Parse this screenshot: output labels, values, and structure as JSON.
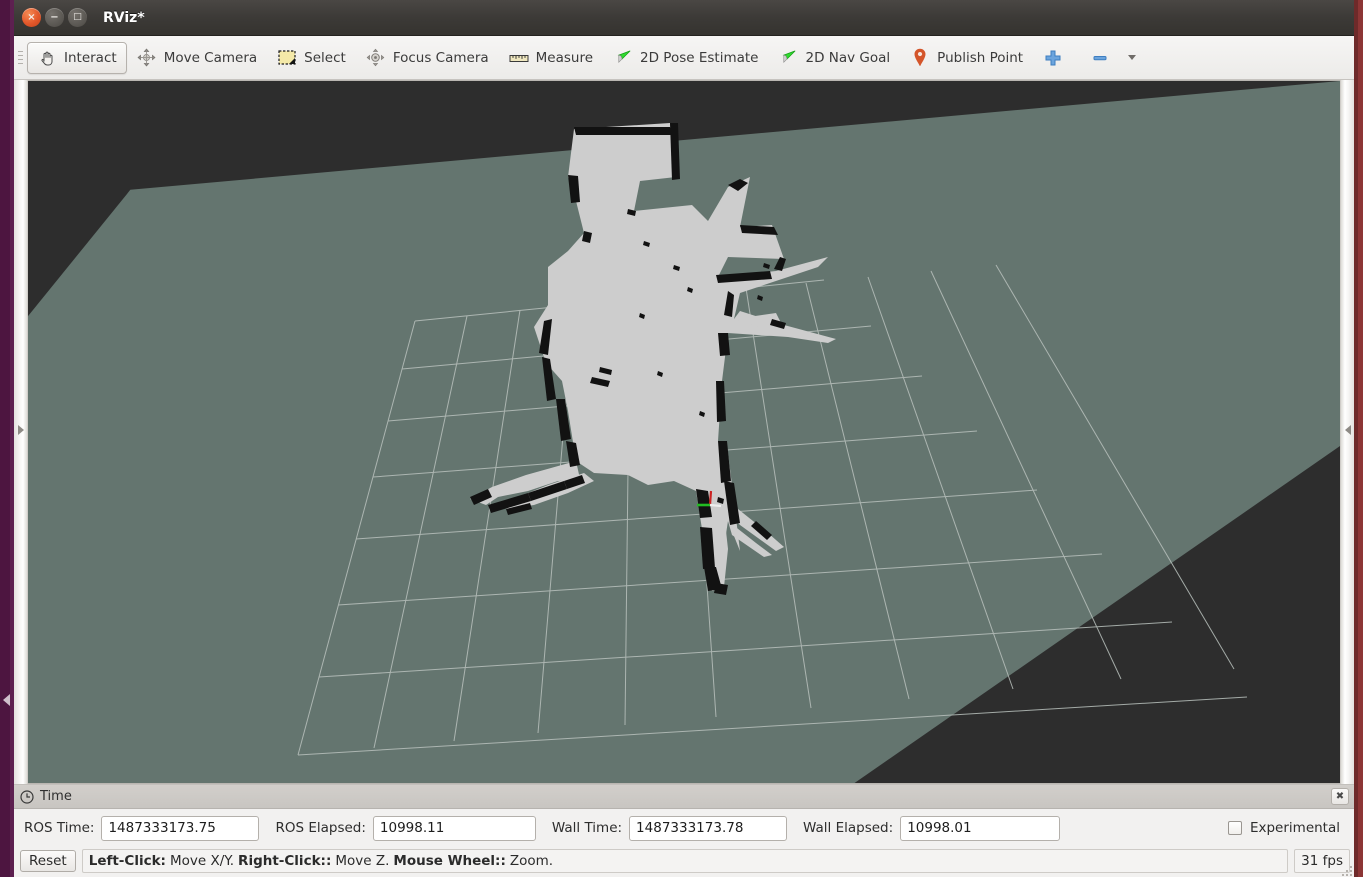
{
  "window": {
    "title": "RViz*",
    "close_glyph": "×",
    "minimize_glyph": "−",
    "maximize_glyph": "□"
  },
  "toolbar": {
    "items": [
      {
        "label": "Interact",
        "icon": "hand-cursor-icon",
        "active": true
      },
      {
        "label": "Move Camera",
        "icon": "move-camera-icon",
        "active": false
      },
      {
        "label": "Select",
        "icon": "select-box-icon",
        "active": false
      },
      {
        "label": "Focus Camera",
        "icon": "focus-camera-icon",
        "active": false
      },
      {
        "label": "Measure",
        "icon": "ruler-icon",
        "active": false
      },
      {
        "label": "2D Pose Estimate",
        "icon": "green-arrow-icon",
        "active": false
      },
      {
        "label": "2D Nav Goal",
        "icon": "green-arrow-icon",
        "active": false
      },
      {
        "label": "Publish Point",
        "icon": "map-pin-icon",
        "active": false
      },
      {
        "label": "",
        "icon": "plus-icon",
        "active": false
      },
      {
        "label": "",
        "icon": "minus-icon",
        "active": false
      }
    ]
  },
  "viewport": {
    "sky_color": "#2d2d2d",
    "ground_color": "#64756f",
    "grid_color": "#b8c0bc",
    "map_free_color": "#cdcdcd",
    "map_occupied_color": "#161616",
    "axes": {
      "x_color": "#cc2222",
      "y_color": "#22bb22",
      "z_color": "#eeeeee"
    }
  },
  "side_panels": {
    "left_expand_arrow": "chevron-right",
    "right_expand_arrow": "chevron-left"
  },
  "time_panel": {
    "title": "Time",
    "icon": "clock-icon",
    "close_glyph": "✖",
    "fields": [
      {
        "label": "ROS Time:",
        "value": "1487333173.75"
      },
      {
        "label": "ROS Elapsed:",
        "value": "10998.11"
      },
      {
        "label": "Wall Time:",
        "value": "1487333173.78"
      },
      {
        "label": "Wall Elapsed:",
        "value": "10998.01"
      }
    ],
    "experimental": {
      "label": "Experimental",
      "checked": false
    }
  },
  "statusbar": {
    "reset_label": "Reset",
    "hints": [
      {
        "bold": "Left-Click:",
        "text": " Move X/Y."
      },
      {
        "bold": "Right-Click::",
        "text": " Move Z."
      },
      {
        "bold": "Mouse Wheel::",
        "text": " Zoom."
      }
    ],
    "fps": "31 fps"
  }
}
